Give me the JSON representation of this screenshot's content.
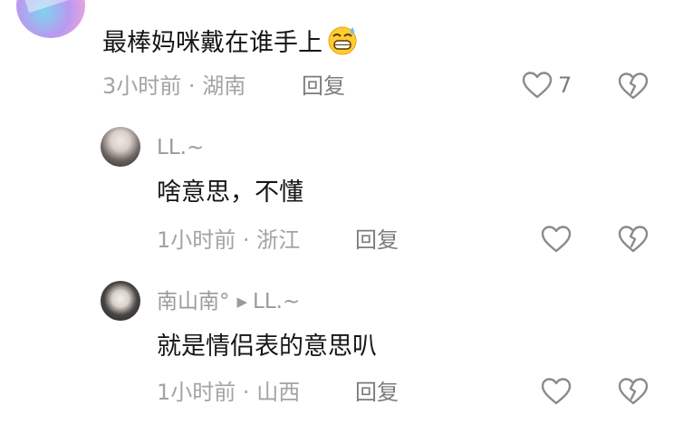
{
  "comments": [
    {
      "text": "最棒妈咪戴在谁手上",
      "emoji": "grinning-sweat-emoji",
      "time": "3小时前",
      "location": "湖南",
      "reply_label": "回复",
      "like_count": "7"
    },
    {
      "username": "LL.~",
      "text": "啥意思，不懂",
      "time": "1小时前",
      "location": "浙江",
      "reply_label": "回复"
    },
    {
      "username": "南山南°",
      "reply_to": "LL.~",
      "text": "就是情侣表的意思叭",
      "time": "1小时前",
      "location": "山西",
      "reply_label": "回复"
    }
  ],
  "separator": "·",
  "icons": {
    "like": "heart-outline-icon",
    "dislike": "broken-heart-icon",
    "reply_arrow": "play-arrow-icon"
  },
  "colors": {
    "text": "#161616",
    "meta": "#a3a3a3",
    "icon": "#8a8a8a"
  }
}
